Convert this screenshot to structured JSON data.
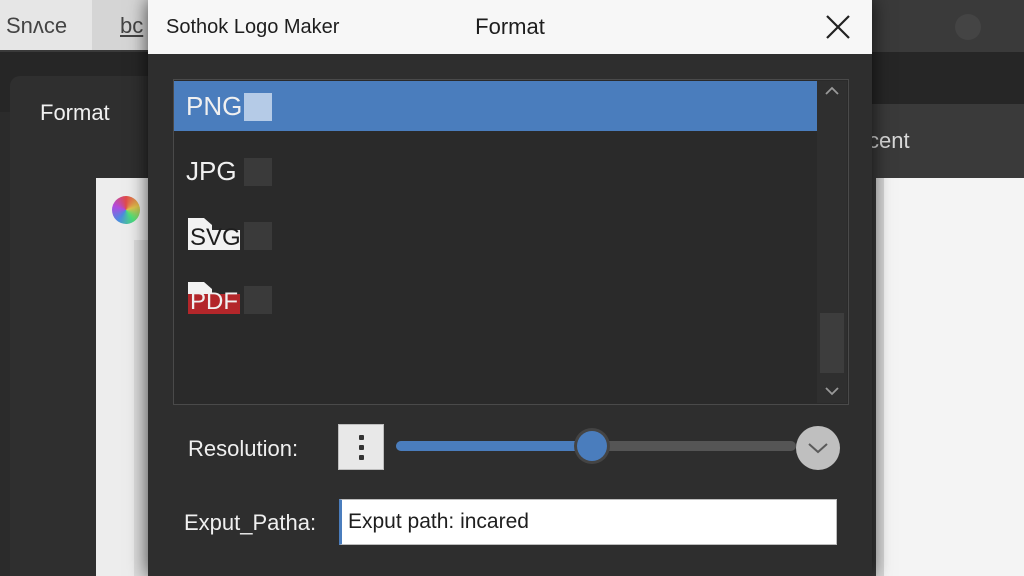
{
  "background": {
    "tab1_label": "Snʌce",
    "tab2_label": "bc",
    "panel_title": "Format",
    "right_label": "cent"
  },
  "dialog": {
    "app_name": "Sothok Logo Maker",
    "title": "Format",
    "close_icon": "close-icon"
  },
  "formats": {
    "selected_index": 0,
    "items": [
      {
        "label": "PNG",
        "icon": "none"
      },
      {
        "label": "JPG",
        "icon": "none"
      },
      {
        "label": "SVG",
        "icon": "svg-file-icon"
      },
      {
        "label": "PDF",
        "icon": "pdf-file-icon"
      }
    ],
    "scroll_up_icon": "chevron-up-icon",
    "scroll_down_icon": "chevron-down-icon"
  },
  "resolution": {
    "label": "Resolution:",
    "menu_icon": "more-vertical-icon",
    "level_fraction": 0.49,
    "dropdown_icon": "chevron-down-icon"
  },
  "output_path": {
    "label": "Exput_Patha:",
    "value": "Exput path: incared"
  },
  "colors": {
    "accent": "#4a7dbd",
    "dialog_bg": "#2e2e2e",
    "titlebar_bg": "#f7f7f7",
    "pdf_red": "#b3262a"
  }
}
